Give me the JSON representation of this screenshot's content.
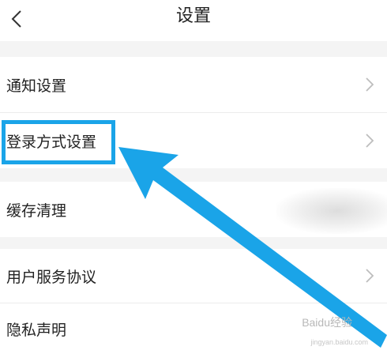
{
  "header": {
    "title": "设置",
    "back_icon": "chevron-left-icon"
  },
  "settings": {
    "items": [
      {
        "label": "通知设置"
      },
      {
        "label": "登录方式设置"
      },
      {
        "label": "缓存清理"
      },
      {
        "label": "用户服务协议"
      },
      {
        "label": "隐私声明"
      }
    ]
  },
  "annotation": {
    "color": "#1aa4e8"
  },
  "watermark": {
    "text": "Baidu经验",
    "subtext": "jingyan.baidu.com"
  }
}
